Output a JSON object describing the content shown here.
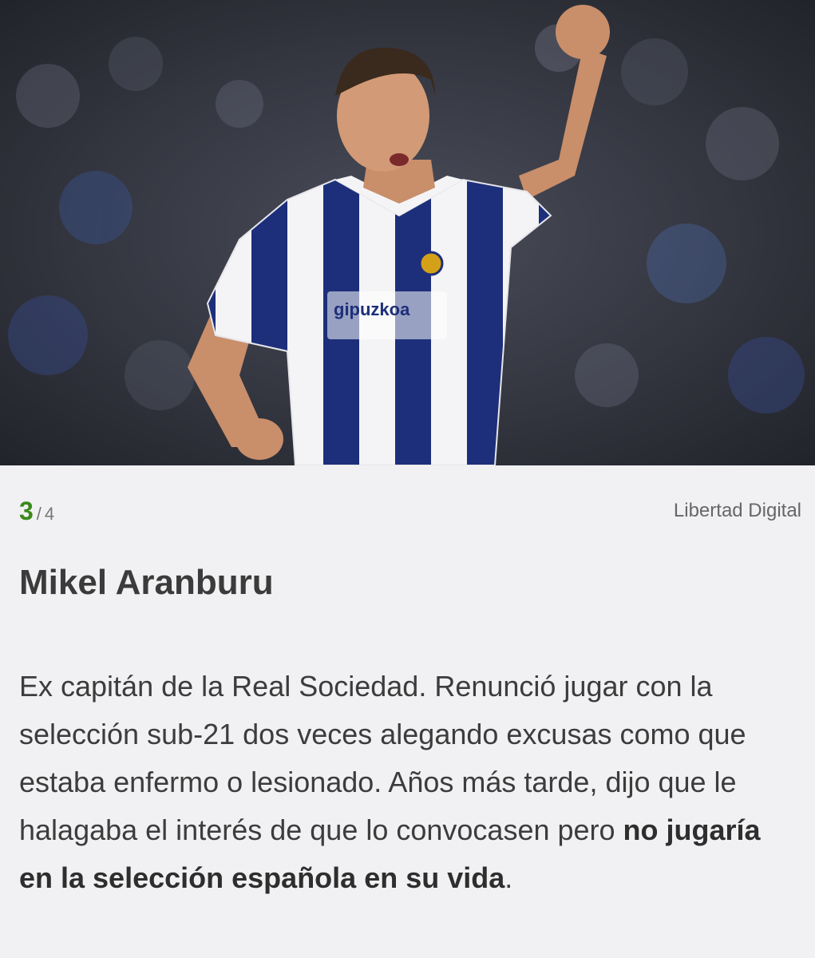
{
  "photo": {
    "subject": "Mikel Aranburu celebrating in Real Sociedad kit",
    "shirt_sponsor": "gipuzkoa"
  },
  "gallery": {
    "current": "3",
    "separator": "/",
    "total": "4",
    "source": "Libertad Digital"
  },
  "article": {
    "title": "Mikel Aranburu",
    "body_plain": "Ex capitán de la Real Sociedad. Renunció jugar con la selección sub-21 dos veces alegando excusas como que estaba enfermo o lesionado. Años más tarde,  dijo que le halagaba el interés de que lo convocasen pero ",
    "body_bold": "no jugaría en la selección española en su vida",
    "body_end": "."
  },
  "colors": {
    "accent": "#3a8a1a",
    "background": "#f1f1f3",
    "text": "#3a3a3a"
  }
}
